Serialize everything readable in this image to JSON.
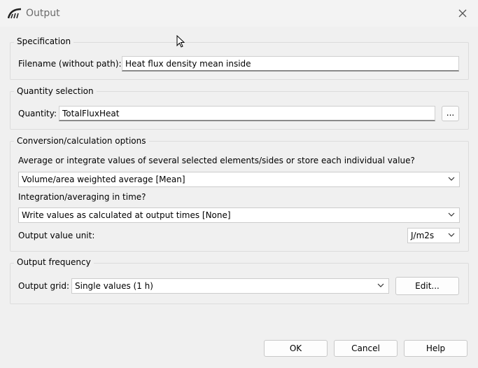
{
  "window": {
    "title": "Output",
    "icon": "app-logo-icon",
    "close_icon": "close-icon"
  },
  "specification": {
    "legend": "Specification",
    "filename_label": "Filename (without path):",
    "filename_value": "Heat flux density mean inside"
  },
  "quantity_selection": {
    "legend": "Quantity selection",
    "quantity_label": "Quantity:",
    "quantity_value": "TotalFluxHeat",
    "browse_label": "..."
  },
  "conversion": {
    "legend": "Conversion/calculation options",
    "average_question": "Average or integrate values of several selected elements/sides or store each individual value?",
    "average_value": "Volume/area weighted average [Mean]",
    "time_question": "Integration/averaging in time?",
    "time_value": "Write values as calculated at output times [None]",
    "unit_label": "Output value unit:",
    "unit_value": "J/m2s"
  },
  "output_frequency": {
    "legend": "Output frequency",
    "grid_label": "Output grid:",
    "grid_value": "Single values (1 h)",
    "edit_label": "Edit..."
  },
  "footer": {
    "ok_label": "OK",
    "cancel_label": "Cancel",
    "help_label": "Help"
  }
}
